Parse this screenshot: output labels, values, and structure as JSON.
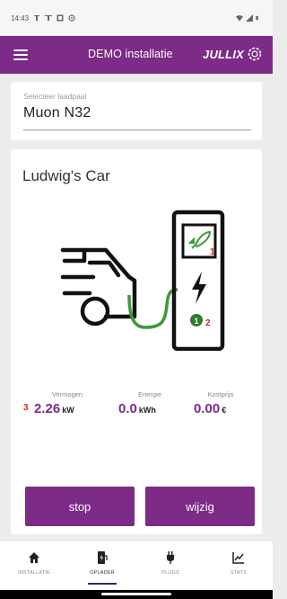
{
  "status_bar": {
    "time": "14:43"
  },
  "app_bar": {
    "title": "DEMO installatie",
    "brand": "JULLIX"
  },
  "selector": {
    "label": "Selecteer laadpaal",
    "value": "Muon N32"
  },
  "car": {
    "name": "Ludwig's Car"
  },
  "illustration": {
    "markers": [
      "1",
      "2"
    ],
    "cable_color": "#3a9a3a",
    "badge_color": "#2f7a2f",
    "marker_color": "#d22222"
  },
  "stats": {
    "marker": "3",
    "vermogen": {
      "label": "Vermogen",
      "value": "2.26",
      "unit": "kW"
    },
    "energie": {
      "label": "Energie",
      "value": "0.0",
      "unit": "kWh"
    },
    "kostprijs": {
      "label": "Kostprijs",
      "value": "0.00",
      "unit": "€"
    }
  },
  "buttons": {
    "stop": "stop",
    "edit": "wijzig"
  },
  "nav": {
    "items": [
      {
        "label": "INSTALLATIE",
        "icon": "home-icon"
      },
      {
        "label": "OPLADER",
        "icon": "charger-icon"
      },
      {
        "label": "PLUGS",
        "icon": "plug-icon"
      },
      {
        "label": "STATS",
        "icon": "chart-icon"
      }
    ],
    "active_index": 1
  },
  "colors": {
    "primary": "#7c2b86",
    "background": "#ececec"
  }
}
